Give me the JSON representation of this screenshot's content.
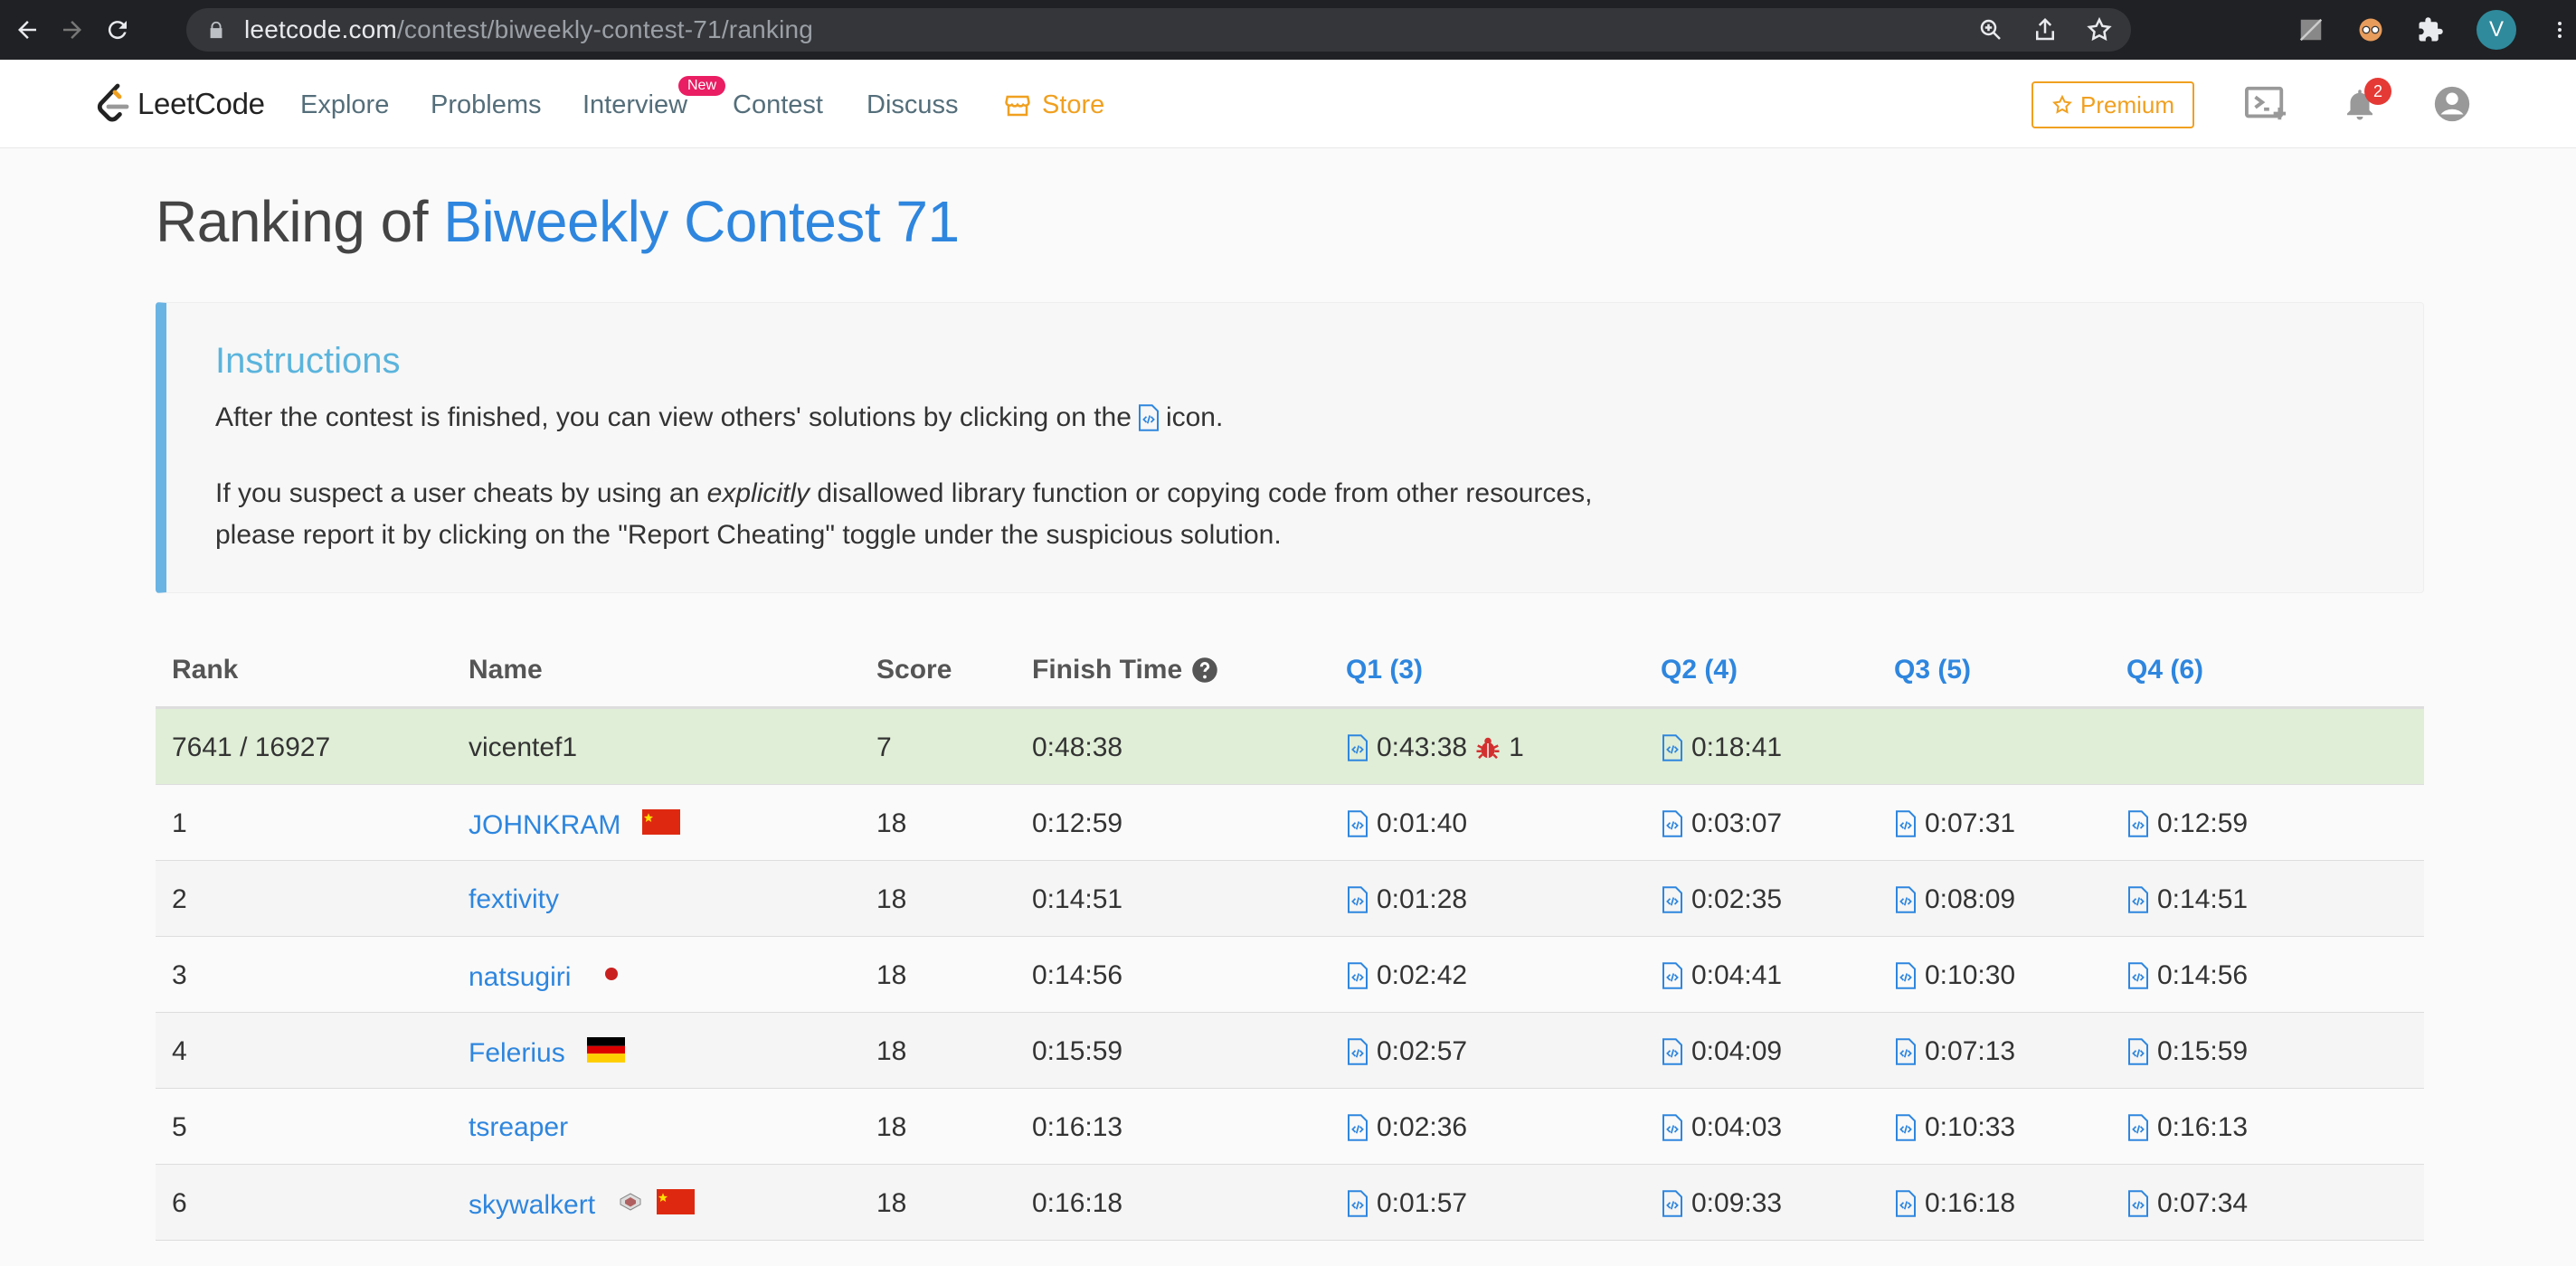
{
  "browser": {
    "url_host": "leetcode.com",
    "url_path": "/contest/biweekly-contest-71/ranking",
    "profile_initial": "V"
  },
  "nav": {
    "logo_text": "LeetCode",
    "items": [
      "Explore",
      "Problems",
      "Interview",
      "Contest",
      "Discuss"
    ],
    "new_badge": "New",
    "store_label": "Store",
    "premium_label": "Premium",
    "notification_count": "2"
  },
  "page": {
    "title_prefix": "Ranking of ",
    "title_contest": "Biweekly Contest 71"
  },
  "instructions": {
    "title": "Instructions",
    "p1_before": "After the contest is finished, you can view others' solutions by clicking on the",
    "p1_after": "icon.",
    "p2_before": "If you suspect a user cheats by using an ",
    "p2_emph": "explicitly",
    "p2_after": " disallowed library function or copying code from other resources,",
    "p2_line2": "please report it by clicking on the \"Report Cheating\" toggle under the suspicious solution."
  },
  "table": {
    "headers": {
      "rank": "Rank",
      "name": "Name",
      "score": "Score",
      "finish": "Finish Time",
      "q1": "Q1 (3)",
      "q2": "Q2 (4)",
      "q3": "Q3 (5)",
      "q4": "Q4 (6)"
    },
    "me": {
      "rank": "7641 / 16927",
      "name": "vicentef1",
      "score": "7",
      "finish": "0:48:38",
      "q1": "0:43:38",
      "q1_bugs": "1",
      "q2": "0:18:41"
    },
    "rows": [
      {
        "rank": "1",
        "name": "JOHNKRAM",
        "score": "18",
        "finish": "0:12:59",
        "q1": "0:01:40",
        "q2": "0:03:07",
        "q3": "0:07:31",
        "q4": "0:12:59"
      },
      {
        "rank": "2",
        "name": "fextivity",
        "score": "18",
        "finish": "0:14:51",
        "q1": "0:01:28",
        "q2": "0:02:35",
        "q3": "0:08:09",
        "q4": "0:14:51"
      },
      {
        "rank": "3",
        "name": "natsugiri",
        "score": "18",
        "finish": "0:14:56",
        "q1": "0:02:42",
        "q2": "0:04:41",
        "q3": "0:10:30",
        "q4": "0:14:56"
      },
      {
        "rank": "4",
        "name": "Felerius",
        "score": "18",
        "finish": "0:15:59",
        "q1": "0:02:57",
        "q2": "0:04:09",
        "q3": "0:07:13",
        "q4": "0:15:59"
      },
      {
        "rank": "5",
        "name": "tsreaper",
        "score": "18",
        "finish": "0:16:13",
        "q1": "0:02:36",
        "q2": "0:04:03",
        "q3": "0:10:33",
        "q4": "0:16:13"
      },
      {
        "rank": "6",
        "name": "skywalkert",
        "score": "18",
        "finish": "0:16:18",
        "q1": "0:01:57",
        "q2": "0:09:33",
        "q3": "0:16:18",
        "q4": "0:07:34"
      }
    ]
  }
}
